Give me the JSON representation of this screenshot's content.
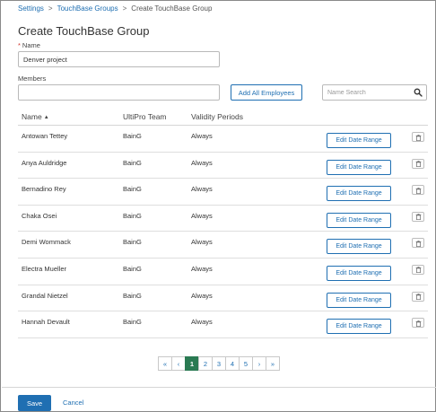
{
  "breadcrumb": {
    "items": [
      "Settings",
      "TouchBase Groups",
      "Create TouchBase Group"
    ],
    "separator": ">"
  },
  "page": {
    "title": "Create TouchBase Group"
  },
  "form": {
    "name_label": "Name",
    "required_mark": "*",
    "name_value": "Denver project",
    "members_label": "Members",
    "members_value": "",
    "add_all_label": "Add All Employees",
    "search_placeholder": "Name Search"
  },
  "table": {
    "columns": [
      "Name",
      "UltiPro Team",
      "Validity Periods"
    ],
    "sort_indicator": "▲",
    "edit_label": "Edit Date Range",
    "rows": [
      {
        "name": "Antowan Tettey",
        "team": "BainG",
        "validity": "Always"
      },
      {
        "name": "Anya Auldridge",
        "team": "BainG",
        "validity": "Always"
      },
      {
        "name": "Bernadino Rey",
        "team": "BainG",
        "validity": "Always"
      },
      {
        "name": "Chaka Osei",
        "team": "BainG",
        "validity": "Always"
      },
      {
        "name": "Demi Wommack",
        "team": "BainG",
        "validity": "Always"
      },
      {
        "name": "Electra Mueller",
        "team": "BainG",
        "validity": "Always"
      },
      {
        "name": "Grandal Nietzel",
        "team": "BainG",
        "validity": "Always"
      },
      {
        "name": "Hannah Devault",
        "team": "BainG",
        "validity": "Always"
      }
    ]
  },
  "pagination": {
    "first": "«",
    "prev": "‹",
    "next": "›",
    "last": "»",
    "pages": [
      "1",
      "2",
      "3",
      "4",
      "5"
    ],
    "current": "1"
  },
  "footer": {
    "save_label": "Save",
    "cancel_label": "Cancel"
  },
  "colors": {
    "accent": "#1f6fb2",
    "active_page": "#2a7a52",
    "required": "#d0342c"
  }
}
